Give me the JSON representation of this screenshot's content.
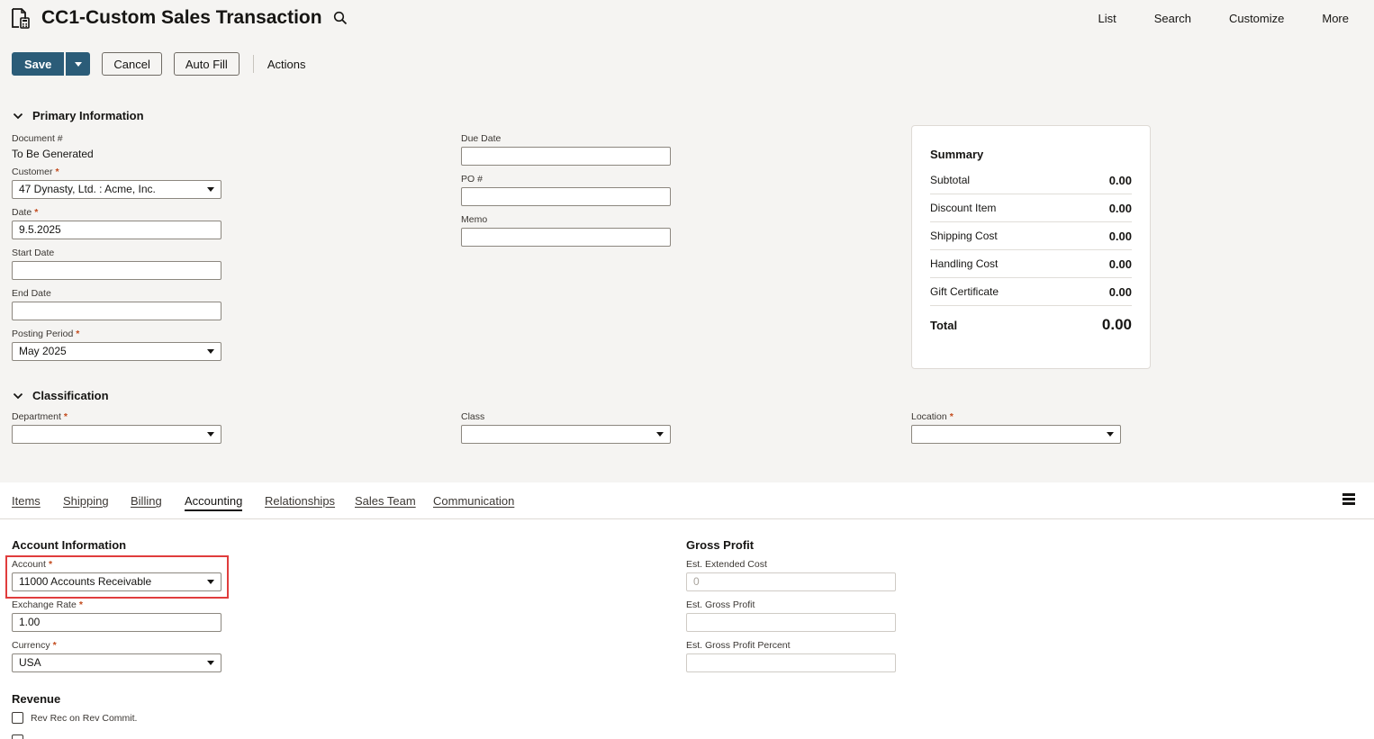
{
  "header": {
    "title": "CC1-Custom Sales Transaction",
    "nav": [
      "List",
      "Search",
      "Customize",
      "More"
    ]
  },
  "toolbar": {
    "save_label": "Save",
    "cancel_label": "Cancel",
    "autofill_label": "Auto Fill",
    "actions_label": "Actions"
  },
  "primary": {
    "section_title": "Primary Information",
    "document_label": "Document #",
    "document_value": "To Be Generated",
    "customer_label": "Customer",
    "customer_value": "47 Dynasty, Ltd. : Acme, Inc.",
    "date_label": "Date",
    "date_value": "9.5.2025",
    "start_date_label": "Start Date",
    "end_date_label": "End Date",
    "posting_period_label": "Posting Period",
    "posting_period_value": "May 2025",
    "due_date_label": "Due Date",
    "po_label": "PO #",
    "memo_label": "Memo"
  },
  "summary": {
    "title": "Summary",
    "rows": [
      {
        "label": "Subtotal",
        "value": "0.00"
      },
      {
        "label": "Discount Item",
        "value": "0.00"
      },
      {
        "label": "Shipping Cost",
        "value": "0.00"
      },
      {
        "label": "Handling Cost",
        "value": "0.00"
      },
      {
        "label": "Gift Certificate",
        "value": "0.00"
      }
    ],
    "total_label": "Total",
    "total_value": "0.00"
  },
  "classification": {
    "section_title": "Classification",
    "department_label": "Department",
    "class_label": "Class",
    "location_label": "Location"
  },
  "tabs": [
    "Items",
    "Shipping",
    "Billing",
    "Accounting",
    "Relationships",
    "Sales Team",
    "Communication"
  ],
  "accounting": {
    "account_info_title": "Account Information",
    "account_label": "Account",
    "account_value": "11000 Accounts Receivable",
    "exchange_rate_label": "Exchange Rate",
    "exchange_rate_value": "1.00",
    "currency_label": "Currency",
    "currency_value": "USA",
    "gross_profit_title": "Gross Profit",
    "est_extended_cost_label": "Est. Extended Cost",
    "est_extended_cost_placeholder": "0",
    "est_gross_profit_label": "Est. Gross Profit",
    "est_gross_profit_percent_label": "Est. Gross Profit Percent",
    "revenue_title": "Revenue",
    "rev_rec_label": "Rev Rec on Rev Commit."
  },
  "colors": {
    "primary_button": "#2b5c78",
    "required_marker": "#c34a1c",
    "highlight_border": "#e03c3c",
    "header_background": "#f5f4f2"
  }
}
